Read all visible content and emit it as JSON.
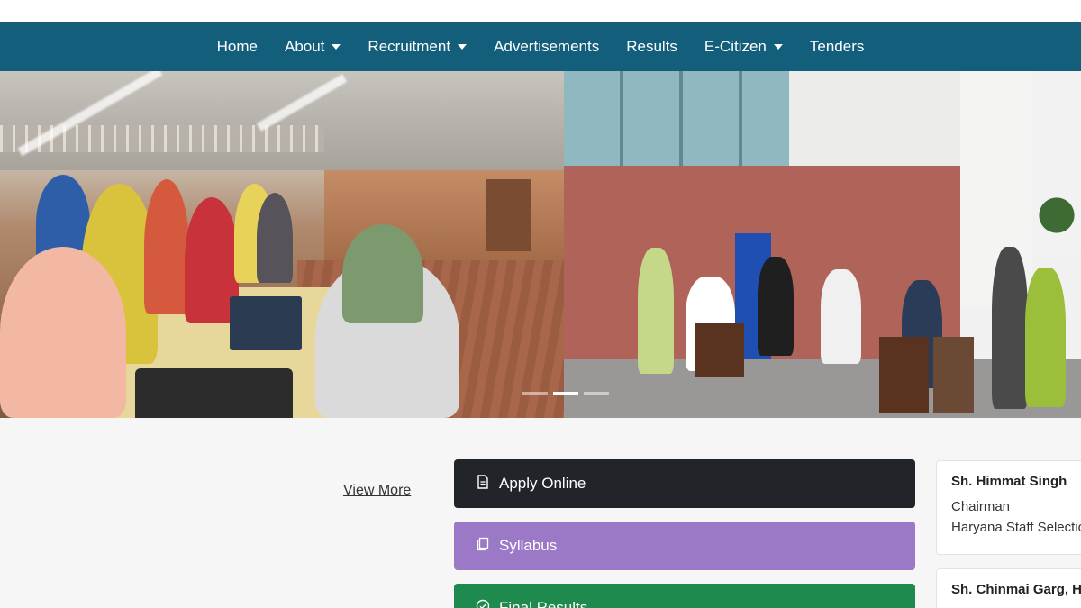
{
  "navbar": {
    "items": [
      {
        "label": "Home",
        "dropdown": false
      },
      {
        "label": "About",
        "dropdown": true
      },
      {
        "label": "Recruitment",
        "dropdown": true
      },
      {
        "label": "Advertisements",
        "dropdown": false
      },
      {
        "label": "Results",
        "dropdown": false
      },
      {
        "label": "E-Citizen",
        "dropdown": true
      },
      {
        "label": "Tenders",
        "dropdown": false
      }
    ],
    "background": "#135f7b"
  },
  "carousel": {
    "active_slide": 2,
    "slide_count": 3
  },
  "links": {
    "view_more": "View More"
  },
  "actions": [
    {
      "label": "Apply Online",
      "icon": "document-icon",
      "color": "#212529"
    },
    {
      "label": "Syllabus",
      "icon": "copy-icon",
      "color": "#9b79c7"
    },
    {
      "label": "Final Results",
      "icon": "check-circle-icon",
      "color": "#1e8a4e"
    }
  ],
  "officials": [
    {
      "name": "Sh. Himmat Singh",
      "role": "Chairman",
      "org": "Haryana Staff Selection Commission"
    },
    {
      "name": "Sh. Chinmai Garg, H"
    }
  ]
}
